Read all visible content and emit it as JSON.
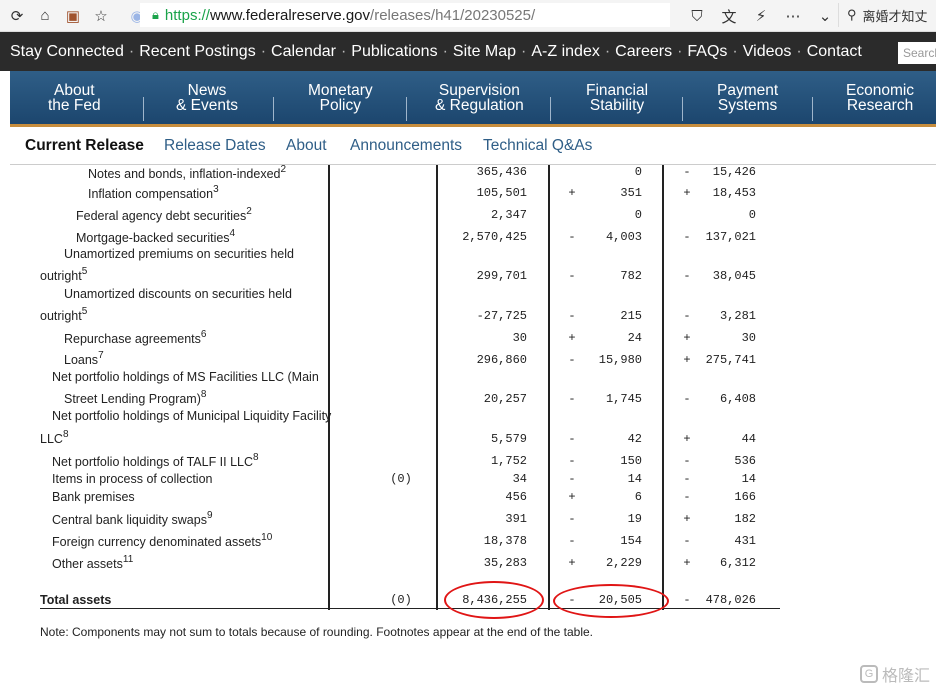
{
  "browser": {
    "url_secure": "https://",
    "url_host": "www.federalreserve.gov",
    "url_path": "/releases/h41/20230525/",
    "search_text": "离婚才知丈"
  },
  "top_nav": [
    "Stay Connected",
    "Recent Postings",
    "Calendar",
    "Publications",
    "Site Map",
    "A-Z index",
    "Careers",
    "FAQs",
    "Videos",
    "Contact"
  ],
  "top_search_placeholder": "Search",
  "main_nav": [
    {
      "line1": "About",
      "line2": "the Fed"
    },
    {
      "line1": "News",
      "line2": "& Events"
    },
    {
      "line1": "Monetary",
      "line2": "Policy"
    },
    {
      "line1": "Supervision",
      "line2": "& Regulation"
    },
    {
      "line1": "Financial",
      "line2": "Stability"
    },
    {
      "line1": "Payment",
      "line2": "Systems"
    },
    {
      "line1": "Economic",
      "line2": "Research"
    }
  ],
  "sub_tabs": [
    "Current Release",
    "Release Dates",
    "About",
    "Announcements",
    "Technical Q&As"
  ],
  "rows": [
    {
      "label": "Notes and bonds, inflation-indexed",
      "sup": "2",
      "col1": "",
      "val": "365,436",
      "s2": "",
      "chg": "0",
      "s3": "-",
      "chg2": "15,426"
    },
    {
      "label": "Inflation compensation",
      "sup": "3",
      "col1": "",
      "val": "105,501",
      "s2": "+",
      "chg": "351",
      "s3": "+",
      "chg2": "18,453"
    },
    {
      "label": "Federal agency debt securities",
      "sup": "2",
      "col1": "",
      "val": "2,347",
      "s2": "",
      "chg": "0",
      "s3": "",
      "chg2": "0"
    },
    {
      "label": "Mortgage-backed securities",
      "sup": "4",
      "col1": "",
      "val": "2,570,425",
      "s2": "-",
      "chg": "4,003",
      "s3": "-",
      "chg2": "137,021"
    },
    {
      "label_a": "Unamortized premiums on securities held",
      "label": "outright",
      "sup": "5",
      "col1": "",
      "val": "299,701",
      "s2": "-",
      "chg": "782",
      "s3": "-",
      "chg2": "38,045"
    },
    {
      "label_a": "Unamortized discounts on securities held",
      "label": "outright",
      "sup": "5",
      "col1": "",
      "val": "-27,725",
      "s2": "-",
      "chg": "215",
      "s3": "-",
      "chg2": "3,281"
    },
    {
      "label": "Repurchase agreements",
      "sup": "6",
      "col1": "",
      "val": "30",
      "s2": "+",
      "chg": "24",
      "s3": "+",
      "chg2": "30"
    },
    {
      "label": "Loans",
      "sup": "7",
      "col1": "",
      "val": "296,860",
      "s2": "-",
      "chg": "15,980",
      "s3": "+",
      "chg2": "275,741"
    },
    {
      "label_a": "Net portfolio holdings of MS Facilities LLC (Main",
      "label": "Street Lending Program)",
      "sup": "8",
      "col1": "",
      "val": "20,257",
      "s2": "-",
      "chg": "1,745",
      "s3": "-",
      "chg2": "6,408"
    },
    {
      "label_a": "Net portfolio holdings of Municipal Liquidity Facility",
      "label": "LLC",
      "sup": "8",
      "col1": "",
      "val": "5,579",
      "s2": "-",
      "chg": "42",
      "s3": "+",
      "chg2": "44"
    },
    {
      "label": "Net portfolio holdings of TALF II LLC",
      "sup": "8",
      "col1": "",
      "val": "1,752",
      "s2": "-",
      "chg": "150",
      "s3": "-",
      "chg2": "536"
    },
    {
      "label": "Items in process of collection",
      "sup": "",
      "col1": "(0)",
      "val": "34",
      "s2": "-",
      "chg": "14",
      "s3": "-",
      "chg2": "14"
    },
    {
      "label": "Bank premises",
      "sup": "",
      "col1": "",
      "val": "456",
      "s2": "+",
      "chg": "6",
      "s3": "-",
      "chg2": "166"
    },
    {
      "label": "Central bank liquidity swaps",
      "sup": "9",
      "col1": "",
      "val": "391",
      "s2": "-",
      "chg": "19",
      "s3": "+",
      "chg2": "182"
    },
    {
      "label": "Foreign currency denominated assets",
      "sup": "10",
      "col1": "",
      "val": "18,378",
      "s2": "-",
      "chg": "154",
      "s3": "-",
      "chg2": "431"
    },
    {
      "label": "Other assets",
      "sup": "11",
      "col1": "",
      "val": "35,283",
      "s2": "+",
      "chg": "2,229",
      "s3": "+",
      "chg2": "6,312"
    }
  ],
  "total": {
    "label": "Total assets",
    "col1": "(0)",
    "val": "8,436,255",
    "s2": "-",
    "chg": "20,505",
    "s3": "-",
    "chg2": "478,026"
  },
  "note": "Note: Components may not sum to totals because of rounding. Footnotes appear at the end of the table.",
  "watermark": "格隆汇",
  "colors": {
    "nav_dark": "#2b2b2b",
    "nav_blue": "#1c466e",
    "accent": "#c78d3d",
    "link": "#2f5e87",
    "annotation": "#e01515"
  }
}
